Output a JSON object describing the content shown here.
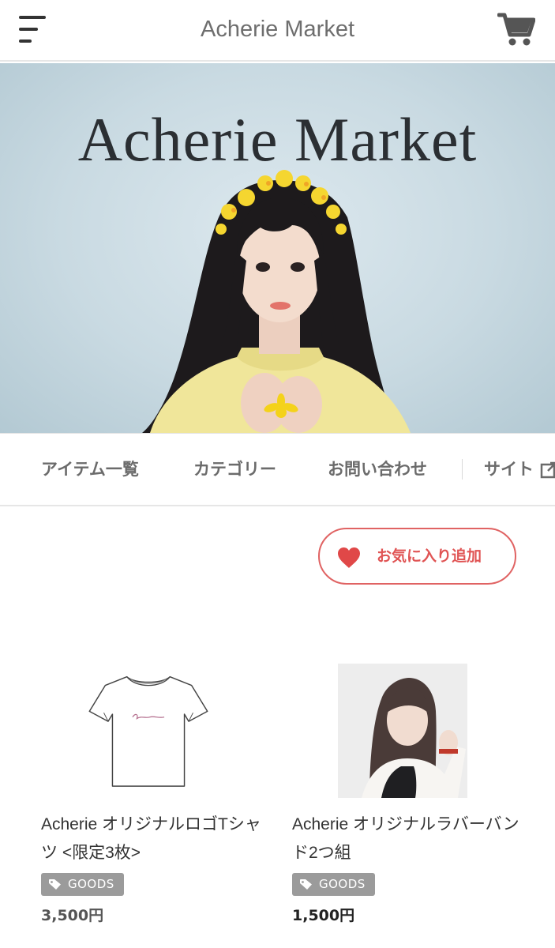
{
  "header": {
    "title": "Acherie Market",
    "menu_icon": "hamburger-menu-icon",
    "cart_icon": "shopping-cart-icon"
  },
  "hero": {
    "title": "Acherie Market"
  },
  "nav": {
    "items": [
      {
        "label": "アイテム一覧"
      },
      {
        "label": "カテゴリー"
      },
      {
        "label": "お問い合わせ"
      },
      {
        "label": "サイト"
      }
    ],
    "external_icon": "external-link-icon"
  },
  "favorite": {
    "label": "お気に入り追加",
    "icon": "heart-icon"
  },
  "products": [
    {
      "name": "Acherie オリジナルロゴTシャツ <限定3枚>",
      "tag": "GOODS",
      "price": "3,500円"
    },
    {
      "name": "Acherie オリジナルラバーバンド2つ組",
      "tag": "GOODS",
      "price": "1,500円"
    }
  ],
  "colors": {
    "accent_red": "#e05454",
    "text_gray": "#6b6b6b",
    "tag_gray": "#9b9b9b",
    "hero_bg": "#c9dae2"
  }
}
